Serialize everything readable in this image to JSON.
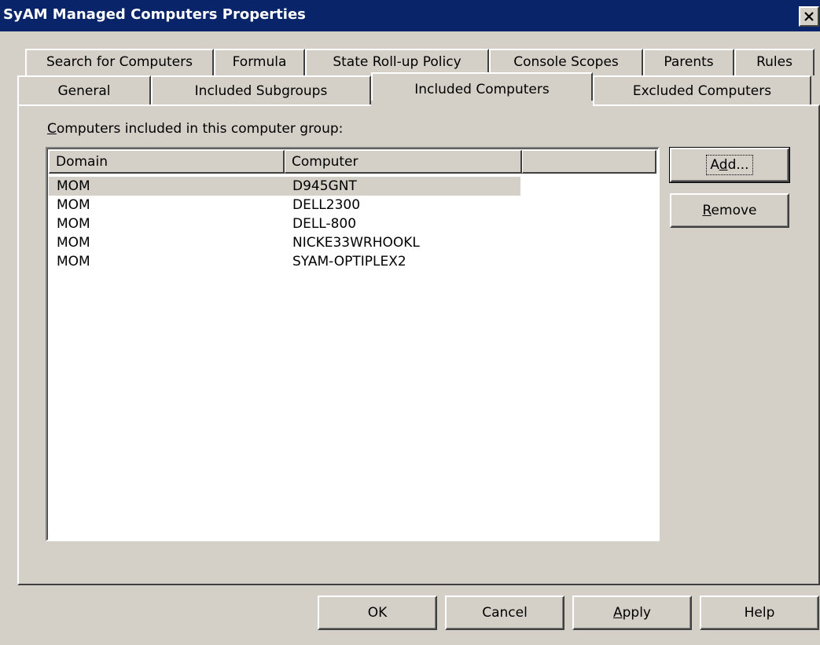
{
  "window": {
    "title": "SyAM Managed Computers Properties",
    "close_glyph": "close-icon"
  },
  "tabs_row1": [
    "Search for Computers",
    "Formula",
    "State Roll-up Policy",
    "Console Scopes",
    "Parents",
    "Rules"
  ],
  "tabs_row2": [
    "General",
    "Included Subgroups",
    "Included Computers",
    "Excluded Computers"
  ],
  "selected_tab": "Included Computers",
  "panel": {
    "caption_first": "C",
    "caption_rest": "omputers included in this computer group:"
  },
  "list": {
    "columns": [
      "Domain",
      "Computer"
    ],
    "rows": [
      [
        "MOM",
        "D945GNT"
      ],
      [
        "MOM",
        "DELL2300"
      ],
      [
        "MOM",
        "DELL-800"
      ],
      [
        "MOM",
        "NICKE33WRHOOKL"
      ],
      [
        "MOM",
        "SYAM-OPTIPLEX2"
      ]
    ],
    "selected_row": 0
  },
  "buttons": {
    "add": {
      "pre": "A",
      "key": "d",
      "post": "d..."
    },
    "remove": {
      "key": "R",
      "post": "emove"
    },
    "ok": "OK",
    "cancel": "Cancel",
    "apply": {
      "key": "A",
      "post": "pply"
    },
    "help": "Help"
  }
}
